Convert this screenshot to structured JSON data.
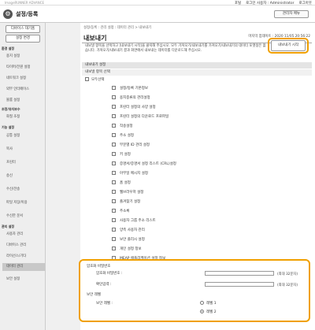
{
  "topbar": {
    "product": "ImageRUNNER ADVANCE",
    "links": [
      "포털",
      "로그인 사용자 : Administrator",
      "로그아웃"
    ]
  },
  "header": {
    "title": "설정/등록",
    "portal_button": "관리자 메뉴"
  },
  "sidebar": {
    "buttons": [
      "디바이스 대기홈",
      "설정 변경"
    ],
    "groups": [
      {
        "title": "환경 설정",
        "items": [
          "용지 설정",
          "타이머/전원 설정",
          "네트워크 설정",
          "외부 인터페이스",
          "볼륨 설정"
        ]
      },
      {
        "title": "조정/유지보수",
        "items": [
          "화질 조정"
        ]
      },
      {
        "title": "기능 설정",
        "items": [
          "공통 설정",
          "복사",
          "프린터",
          "송신",
          "수신/전송",
          "파일 저장/이용",
          "수신한 문서"
        ]
      },
      {
        "title": "관리 설정",
        "items": [
          "사용자 관리",
          "디바이스 관리",
          "라이선스/기타",
          "데이터 관리",
          "보안 설정"
        ]
      }
    ],
    "active": "데이터 관리"
  },
  "main": {
    "breadcrumb": "설정/등록 : 관리 설정 : 데이터 관리 > 내보내기",
    "title": "내보내기",
    "last_update": "마지막 업데이트 : 2020 11/05 20:56:22",
    "description": "내보낼 항목을 선택하고 [내보내기 시작]을 클릭해 주십시오. 모두 가져오기/내보내기를 가져오기/내보내기의 데이터 포맷정은 없습니다. 가져오기/내보내기 결과 화면에서 내보내는 데이터를 다운로드해 주십시오.",
    "start_button": "내보내기 시작",
    "section_settings": "내보내기 설정",
    "section_select": "내보낼 항목 선택",
    "select_all": "모두선택",
    "items": [
      "설정/등록 기본정보",
      "용지종류의 관리설정",
      "프린터 설정의 사양 설정",
      "프린터 설정의 다운로드 프로파일",
      "작송설정",
      "주소 설정",
      "부문별 ID 관리 설정",
      "키 설정",
      "증명서/증명서 설정 리스트 (CRL)설정",
      "아무일 메시지 설정",
      "홈 설정",
      "웹브라우저 설정",
      "즐겨찾기 설정",
      "주소록",
      "사용자 그룹 주소 리스트",
      "양측 사용자 관리",
      "보안 플리시 설정",
      "개인 설정 정보",
      "MEAP 애플리케이션 설정 정보"
    ],
    "section_password": "암호화 비밀번호",
    "password_label": "암호화 비밀번호 :",
    "password_max": "(최대 32문자)",
    "confirm_label": "확인입력 :",
    "confirm_max": "(최대 32문자)",
    "security_label": "보안 레벨",
    "security_level_label": "보안 레벨 :",
    "levels": [
      "레벨 1",
      "레벨 2"
    ],
    "selected_level": "레벨 2"
  }
}
